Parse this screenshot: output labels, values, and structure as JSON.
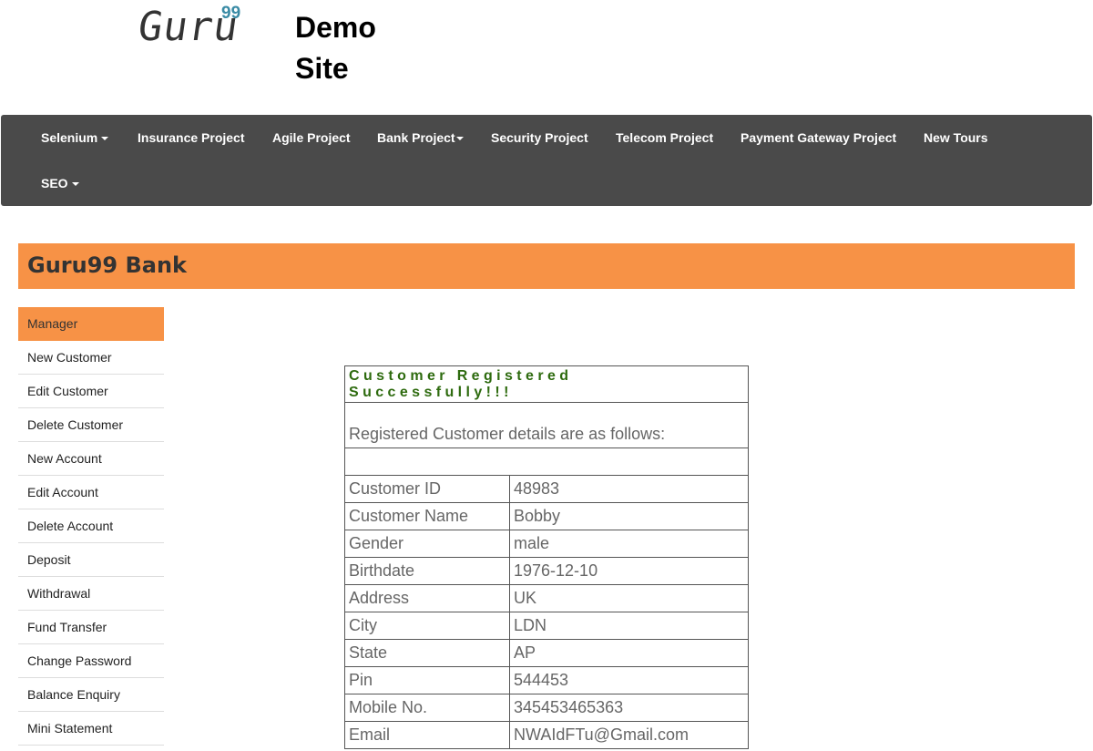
{
  "header": {
    "logo_text": "Guru",
    "logo_sup": "99",
    "site_title": "Demo Site"
  },
  "navbar": {
    "items": [
      {
        "label": "Selenium",
        "dropdown": true
      },
      {
        "label": "Insurance Project",
        "dropdown": false
      },
      {
        "label": "Agile Project",
        "dropdown": false
      },
      {
        "label": "Bank Project",
        "dropdown": true
      },
      {
        "label": "Security Project",
        "dropdown": false
      },
      {
        "label": "Telecom Project",
        "dropdown": false
      },
      {
        "label": "Payment Gateway Project",
        "dropdown": false
      },
      {
        "label": "New Tours",
        "dropdown": false
      },
      {
        "label": "SEO",
        "dropdown": true
      }
    ],
    "background": "#4a4a4a"
  },
  "bank_bar": {
    "title": "Guru99 Bank",
    "color": "#f79246"
  },
  "sidebar": {
    "items": [
      {
        "label": "Manager",
        "active": true
      },
      {
        "label": "New Customer"
      },
      {
        "label": "Edit Customer"
      },
      {
        "label": "Delete Customer"
      },
      {
        "label": "New Account"
      },
      {
        "label": "Edit Account"
      },
      {
        "label": "Delete Account"
      },
      {
        "label": "Deposit"
      },
      {
        "label": "Withdrawal"
      },
      {
        "label": "Fund Transfer"
      },
      {
        "label": "Change Password"
      },
      {
        "label": "Balance Enquiry"
      },
      {
        "label": "Mini Statement"
      }
    ]
  },
  "details": {
    "success_message": "Customer Registered Successfully!!!",
    "subtitle": "Registered Customer details are as follows:",
    "rows": [
      {
        "label": "Customer ID",
        "value": "48983"
      },
      {
        "label": "Customer Name",
        "value": "Bobby"
      },
      {
        "label": "Gender",
        "value": "male"
      },
      {
        "label": "Birthdate",
        "value": "1976-12-10"
      },
      {
        "label": "Address",
        "value": "UK"
      },
      {
        "label": "City",
        "value": "LDN"
      },
      {
        "label": "State",
        "value": "AP"
      },
      {
        "label": "Pin",
        "value": "544453"
      },
      {
        "label": "Mobile No.",
        "value": "345453465363"
      },
      {
        "label": "Email",
        "value": "NWAIdFTu@Gmail.com"
      }
    ]
  }
}
